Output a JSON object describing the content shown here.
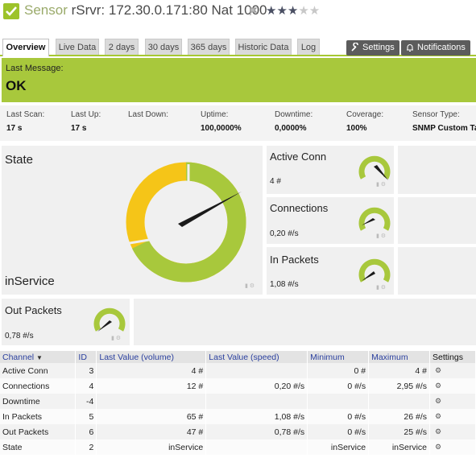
{
  "header": {
    "word": "Sensor",
    "title": "rSrvr: 172.30.0.171:80 Nat 1000",
    "stars_on": "★★★",
    "stars_off": "★★"
  },
  "tabs": [
    "Overview",
    "Live Data",
    "2 days",
    "30 days",
    "365 days",
    "Historic Data",
    "Log"
  ],
  "actions": {
    "settings": "Settings",
    "notifications": "Notifications"
  },
  "message": {
    "label": "Last Message:",
    "value": "OK"
  },
  "info": [
    {
      "label": "Last Scan:",
      "value": "17 s"
    },
    {
      "label": "Last Up:",
      "value": "17 s"
    },
    {
      "label": "Last Down:",
      "value": ""
    },
    {
      "label": "Uptime:",
      "value": "100,0000%"
    },
    {
      "label": "Downtime:",
      "value": "0,0000%"
    },
    {
      "label": "Coverage:",
      "value": "100%"
    },
    {
      "label": "Sensor Type:",
      "value": "SNMP Custom Ta"
    }
  ],
  "panels": {
    "state": {
      "title": "State",
      "value": "inService"
    },
    "active_conn": {
      "title": "Active Conn",
      "value": "4 #"
    },
    "connections": {
      "title": "Connections",
      "value": "0,20 #/s"
    },
    "in_packets": {
      "title": "In Packets",
      "value": "1,08 #/s"
    },
    "out_packets": {
      "title": "Out Packets",
      "value": "0,78 #/s"
    }
  },
  "table": {
    "headers": [
      "Channel",
      "ID",
      "Last Value (volume)",
      "Last Value (speed)",
      "Minimum",
      "Maximum",
      "Settings"
    ],
    "sort_icon": "▼",
    "rows": [
      [
        "Active Conn",
        "3",
        "4 #",
        "",
        "0 #",
        "4 #"
      ],
      [
        "Connections",
        "4",
        "12 #",
        "0,20 #/s",
        "0 #/s",
        "2,95 #/s"
      ],
      [
        "Downtime",
        "-4",
        "",
        "",
        "",
        ""
      ],
      [
        "In Packets",
        "5",
        "65 #",
        "1,08 #/s",
        "0 #/s",
        "26 #/s"
      ],
      [
        "Out Packets",
        "6",
        "47 #",
        "0,78 #/s",
        "0 #/s",
        "25 #/s"
      ],
      [
        "State",
        "2",
        "inService",
        "",
        "inService",
        "inService"
      ]
    ]
  },
  "colors": {
    "green": "#a8c83c",
    "yellow": "#f5c518",
    "needle": "#1a1a1a"
  }
}
